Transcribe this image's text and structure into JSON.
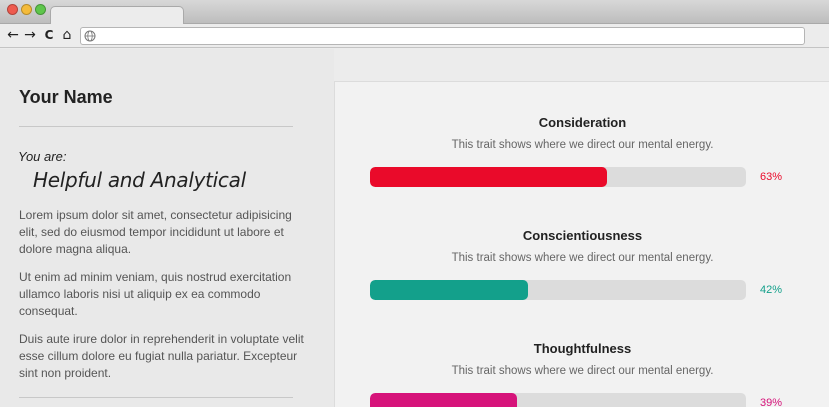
{
  "browser": {
    "nav_back": "←",
    "nav_forward": "→",
    "nav_reload": "C",
    "nav_home": "⌂",
    "url": ""
  },
  "profile": {
    "name": "Your Name",
    "you_are_label": "You are:",
    "result": "Helpful and Analytical",
    "paragraphs": [
      "Lorem ipsum dolor sit amet, consectetur adipisicing elit, sed do eiusmod tempor incididunt ut labore et dolore magna aliqua.",
      "Ut enim ad minim veniam, quis nostrud exercitation ullamco laboris nisi ut aliquip ex ea commodo consequat.",
      "Duis aute irure dolor in reprehenderit in voluptate velit esse cillum dolore eu fugiat nulla pariatur. Excepteur sint  non proident."
    ]
  },
  "traits": [
    {
      "title": "Consideration",
      "description": "This trait shows where we direct our mental energy.",
      "percent": 63,
      "percent_label": "63%",
      "color": "#ea0a2a"
    },
    {
      "title": "Conscientiousness",
      "description": "This trait shows where we direct our mental energy.",
      "percent": 42,
      "percent_label": "42%",
      "color": "#13a08b"
    },
    {
      "title": "Thoughtfulness",
      "description": "This trait shows where we direct our mental energy.",
      "percent": 39,
      "percent_label": "39%",
      "color": "#d6137a"
    }
  ]
}
